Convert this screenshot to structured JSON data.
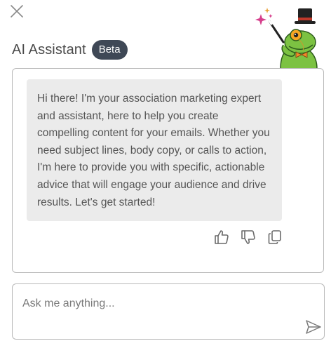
{
  "header": {
    "title": "AI Assistant",
    "badge": "Beta"
  },
  "messages": [
    {
      "role": "assistant",
      "text": "Hi there! I'm your association marketing expert and assistant, here to help you create compelling content for your emails. Whether you need subject lines, body copy, or calls to action, I'm here to provide you with specific, actionable advice that will engage your audience and drive results. Let's get started!"
    }
  ],
  "message_actions": {
    "icons": [
      "thumbs-up-icon",
      "thumbs-down-icon",
      "copy-icon"
    ]
  },
  "composer": {
    "placeholder": "Ask me anything...",
    "value": "",
    "send_icon": "send-icon"
  },
  "icons": {
    "close": "close-icon",
    "mascot": "frog-magician-mascot"
  },
  "colors": {
    "badge_bg": "#3f4856",
    "bubble_bg": "#ebebeb",
    "border": "#b9b9b9",
    "text": "#555555"
  }
}
